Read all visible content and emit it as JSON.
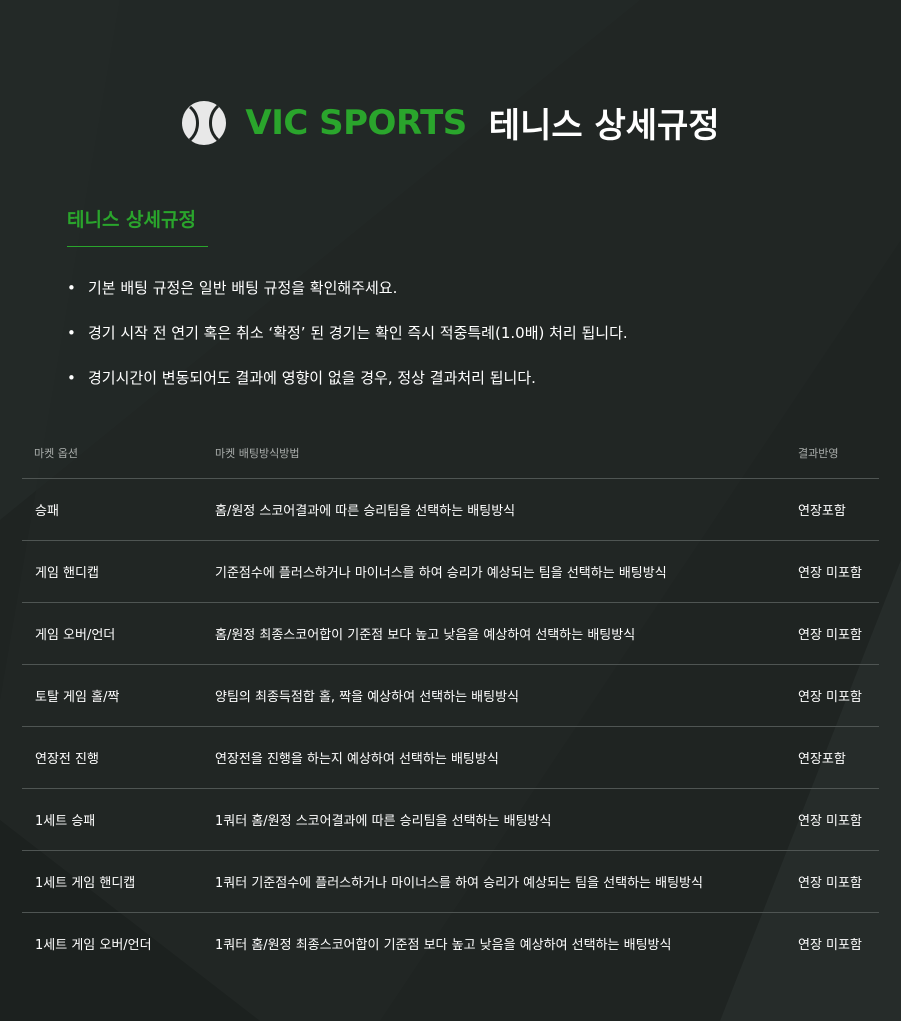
{
  "header": {
    "brand": "VIC SPORTS",
    "title": "테니스 상세규정",
    "brand_color": "#2aa52c",
    "icon": "tennis-ball-icon"
  },
  "section": {
    "title": "테니스 상세규정"
  },
  "rules": [
    "기본 배팅 규정은 일반 배팅 규정을 확인해주세요.",
    "경기 시작 전 연기 혹은 취소 ‘확정’ 된 경기는 확인 즉시 적중특례(1.0배) 처리 됩니다.",
    "경기시간이 변동되어도 결과에 영향이 없을 경우, 정상 결과처리 됩니다."
  ],
  "bullet": "•",
  "table": {
    "headers": [
      "마켓 옵션",
      "마켓 배팅방식방법",
      "결과반영"
    ],
    "rows": [
      [
        "승패",
        "홈/원정 스코어결과에 따른 승리팀을 선택하는 배팅방식",
        "연장포함"
      ],
      [
        "게임 핸디캡",
        "기준점수에 플러스하거나 마이너스를 하여 승리가 예상되는 팀을 선택하는 배팅방식",
        "연장 미포함"
      ],
      [
        "게임 오버/언더",
        "홈/원정 최종스코어합이 기준점 보다 높고 낮음을 예상하여 선택하는 배팅방식",
        "연장 미포함"
      ],
      [
        "토탈 게임 홀/짝",
        "양팀의 최종득점합 홀, 짝을 예상하여 선택하는 배팅방식",
        "연장 미포함"
      ],
      [
        "연장전 진행",
        "연장전을 진행을 하는지 예상하여 선택하는 배팅방식",
        "연장포함"
      ],
      [
        "1세트 승패",
        "1쿼터 홈/원정 스코어결과에 따른 승리팀을 선택하는 배팅방식",
        "연장 미포함"
      ],
      [
        "1세트 게임 핸디캡",
        "1쿼터 기준점수에 플러스하거나 마이너스를 하여 승리가 예상되는 팀을 선택하는 배팅방식",
        "연장 미포함"
      ],
      [
        "1세트 게임 오버/언더",
        "1쿼터 홈/원정 최종스코어합이 기준점 보다 높고 낮음을 예상하여 선택하는 배팅방식",
        "연장 미포함"
      ]
    ]
  }
}
